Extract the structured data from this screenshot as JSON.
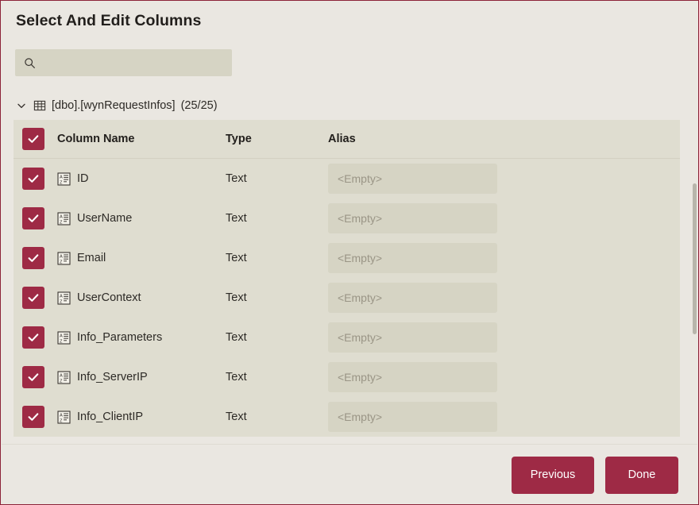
{
  "dialog": {
    "title": "Select And Edit Columns",
    "accent_color": "#9e2a45",
    "background_color": "#eae7e1",
    "grid_background_color": "#dfddd0",
    "field_background_color": "#d6d4c4",
    "border_color": "#8c2338"
  },
  "search": {
    "value": "",
    "placeholder": "",
    "icon": "search-icon"
  },
  "tree": {
    "expand_icon": "chevron-down-icon",
    "table_icon": "table-icon",
    "label": "[dbo].[wynRequestInfos]",
    "count": "(25/25)"
  },
  "grid": {
    "header": {
      "select_all_checked": true,
      "column_name": "Column Name",
      "type": "Type",
      "alias": "Alias"
    },
    "alias_placeholder": "<Empty>",
    "row_icon": "text-column-icon",
    "rows": [
      {
        "checked": true,
        "name": "ID",
        "type": "Text",
        "alias": ""
      },
      {
        "checked": true,
        "name": "UserName",
        "type": "Text",
        "alias": ""
      },
      {
        "checked": true,
        "name": "Email",
        "type": "Text",
        "alias": ""
      },
      {
        "checked": true,
        "name": "UserContext",
        "type": "Text",
        "alias": ""
      },
      {
        "checked": true,
        "name": "Info_Parameters",
        "type": "Text",
        "alias": ""
      },
      {
        "checked": true,
        "name": "Info_ServerIP",
        "type": "Text",
        "alias": ""
      },
      {
        "checked": true,
        "name": "Info_ClientIP",
        "type": "Text",
        "alias": ""
      }
    ]
  },
  "footer": {
    "previous_label": "Previous",
    "done_label": "Done"
  }
}
